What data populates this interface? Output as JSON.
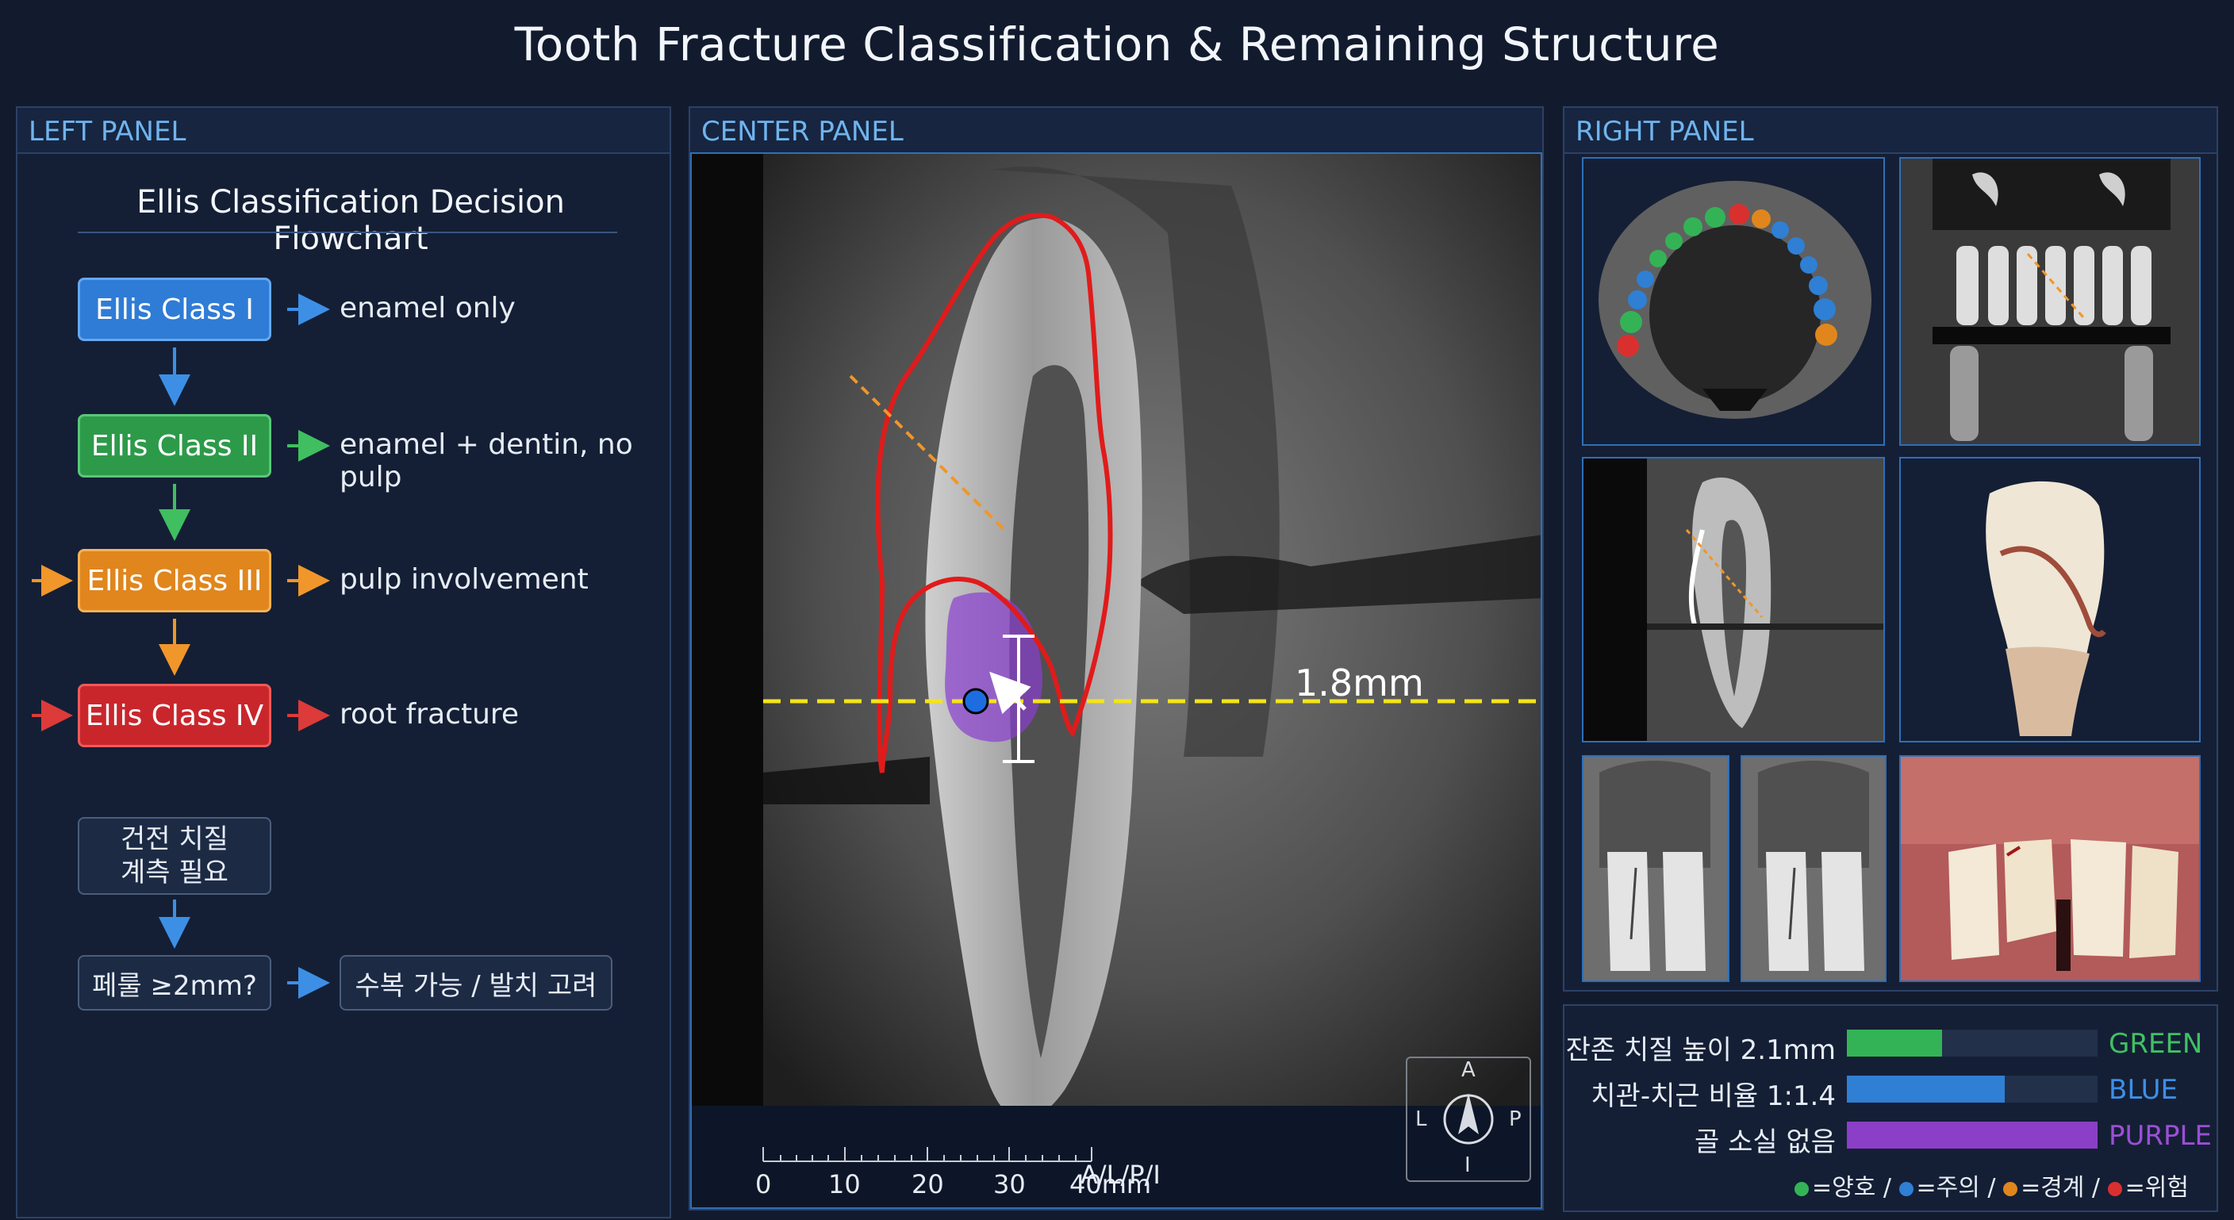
{
  "page_title": "Tooth Fracture Classification & Remaining Structure",
  "left_panel": {
    "header": "LEFT PANEL",
    "flowchart_title": "Ellis Classification Decision Flowchart",
    "classes": [
      {
        "label": "Ellis Class I",
        "desc": "enamel only",
        "color": "#2f7cd6"
      },
      {
        "label": "Ellis Class II",
        "desc": "enamel + dentin, no pulp",
        "color": "#2d9a4a"
      },
      {
        "label": "Ellis Class III",
        "desc": "pulp involvement",
        "color": "#e0861d"
      },
      {
        "label": "Ellis Class IV",
        "desc": "root fracture",
        "color": "#c9262c"
      }
    ],
    "step_measure_line1": "건전 치질",
    "step_measure_line2": "계측 필요",
    "step_ferrule": "페룰 ≥2mm?",
    "step_result": "수복 가능 / 발치 고려"
  },
  "center_panel": {
    "header": "CENTER PANEL",
    "measurement": "1.8mm",
    "orientation_label": "A/L/P/I",
    "compass": {
      "top": "A",
      "left": "L",
      "right": "P",
      "bottom": "I"
    },
    "ruler_labels": [
      "0",
      "10",
      "20",
      "30",
      "40mm"
    ]
  },
  "right_panel": {
    "header": "RIGHT PANEL"
  },
  "metrics": {
    "rows": [
      {
        "label": "잔존 치질 높이 2.1mm",
        "level": 0.38,
        "fill": "#34b356",
        "color_word": "GREEN",
        "word_color": "#41c063"
      },
      {
        "label": "치관-치근 비율 1:1.4",
        "level": 0.63,
        "fill": "#2f7fd4",
        "color_word": "BLUE",
        "word_color": "#3d8fe6"
      },
      {
        "label": "골 소실 없음",
        "level": 1.0,
        "fill": "#8b3fc6",
        "color_word": "PURPLE",
        "word_color": "#9b4fd6"
      }
    ],
    "legend": [
      {
        "text": "=양호 /",
        "color": "#34b356"
      },
      {
        "text": "=주의 /",
        "color": "#2f7fd4"
      },
      {
        "text": "=경계 /",
        "color": "#e0861d"
      },
      {
        "text": "=위험",
        "color": "#d9302f"
      }
    ]
  }
}
